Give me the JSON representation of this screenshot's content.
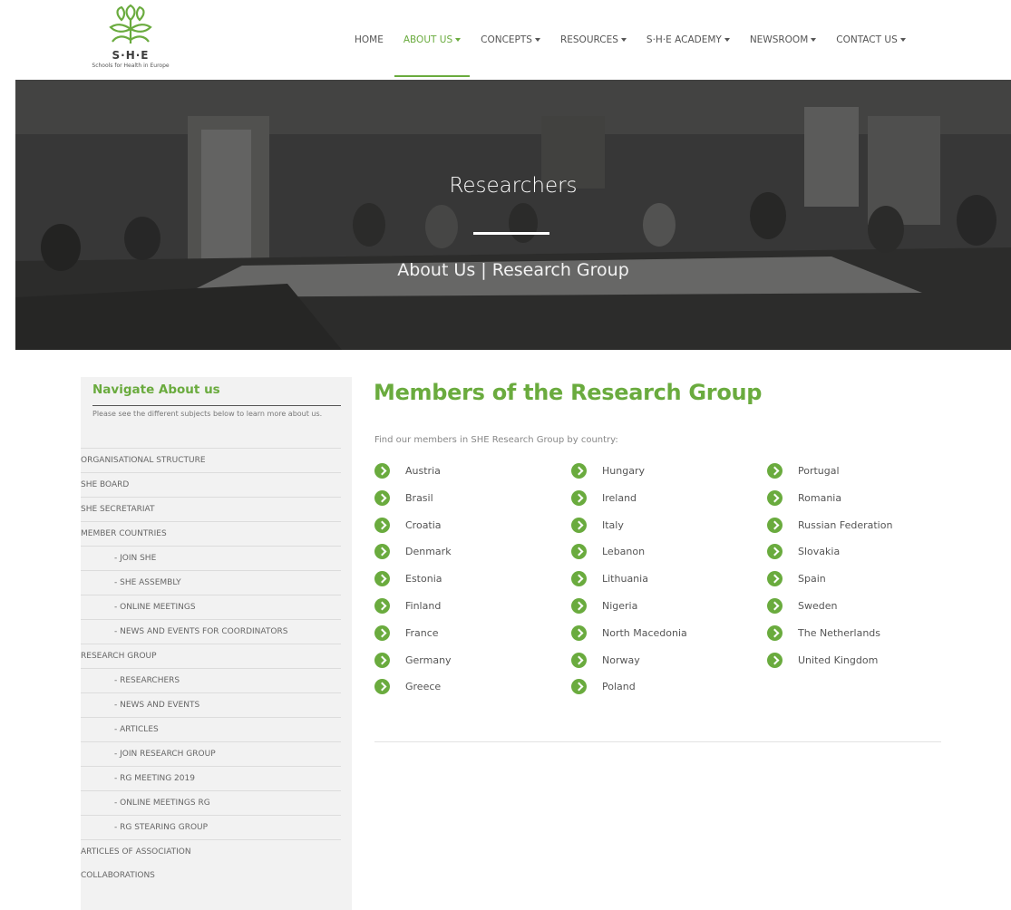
{
  "logo": {
    "name": "S·H·E",
    "tagline": "Schools for Health in Europe"
  },
  "nav": [
    {
      "label": "HOME",
      "dropdown": false,
      "active": false
    },
    {
      "label": "ABOUT US",
      "dropdown": true,
      "active": true
    },
    {
      "label": "CONCEPTS",
      "dropdown": true,
      "active": false
    },
    {
      "label": "RESOURCES",
      "dropdown": true,
      "active": false
    },
    {
      "label": "S·H·E ACADEMY",
      "dropdown": true,
      "active": false
    },
    {
      "label": "NEWSROOM",
      "dropdown": true,
      "active": false
    },
    {
      "label": "CONTACT US",
      "dropdown": true,
      "active": false
    }
  ],
  "hero": {
    "title": "Researchers",
    "subtitle": "About Us | Research Group"
  },
  "sidebar": {
    "title": "Navigate About us",
    "description": "Please see the different subjects below to learn more about us.",
    "items": [
      {
        "label": "ORGANISATIONAL STRUCTURE",
        "sub": false
      },
      {
        "label": "SHE BOARD",
        "sub": false
      },
      {
        "label": "SHE SECRETARIAT",
        "sub": false
      },
      {
        "label": "MEMBER COUNTRIES",
        "sub": false
      },
      {
        "label": "- JOIN SHE",
        "sub": true
      },
      {
        "label": "- SHE ASSEMBLY",
        "sub": true
      },
      {
        "label": "- ONLINE MEETINGS",
        "sub": true
      },
      {
        "label": "- NEWS AND EVENTS FOR COORDINATORS",
        "sub": true
      },
      {
        "label": "RESEARCH GROUP",
        "sub": false
      },
      {
        "label": "- RESEARCHERS",
        "sub": true
      },
      {
        "label": "- NEWS AND EVENTS",
        "sub": true
      },
      {
        "label": "- ARTICLES",
        "sub": true
      },
      {
        "label": "- JOIN RESEARCH GROUP",
        "sub": true
      },
      {
        "label": "- RG MEETING 2019",
        "sub": true
      },
      {
        "label": "- ONLINE MEETINGS RG",
        "sub": true
      },
      {
        "label": "- RG STEARING GROUP",
        "sub": true
      },
      {
        "label": "ARTICLES OF ASSOCIATION",
        "sub": false
      },
      {
        "label": "COLLABORATIONS",
        "sub": false
      }
    ]
  },
  "main": {
    "title": "Members of the Research Group",
    "intro": "Find our members in SHE Research Group by country:",
    "columns": [
      [
        "Austria",
        "Brasil",
        "Croatia",
        "Denmark",
        "Estonia",
        "Finland",
        "France",
        "Germany",
        "Greece"
      ],
      [
        "Hungary",
        "Ireland",
        "Italy",
        "Lebanon",
        "Lithuania",
        "Nigeria",
        "North Macedonia",
        "Norway",
        "Poland"
      ],
      [
        "Portugal",
        "Romania",
        "Russian Federation",
        "Slovakia",
        "Spain",
        "Sweden",
        "The Netherlands",
        "United Kingdom"
      ]
    ]
  },
  "colors": {
    "accent": "#6aab3e",
    "text": "#666666",
    "sidebar_bg": "#f2f2f2"
  },
  "icons": {
    "country_bullet": "chevron-right-circle-icon",
    "dropdown": "caret-down-icon"
  }
}
